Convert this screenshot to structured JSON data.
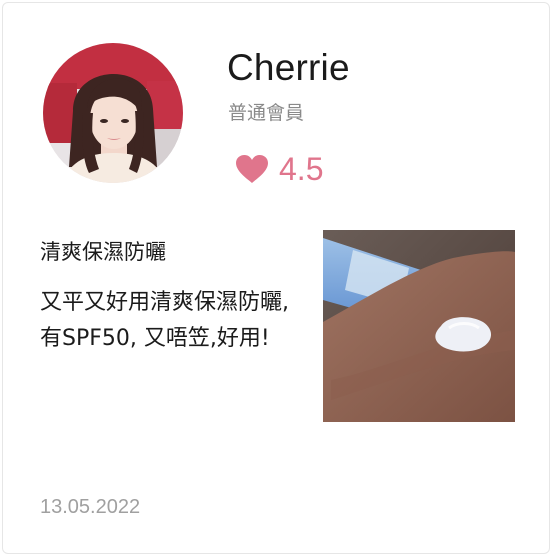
{
  "reviewer": {
    "name": "Cherrie",
    "membership": "普通會員",
    "rating": "4.5",
    "rating_icon": "heart-icon",
    "accent_color": "#e0758c"
  },
  "review": {
    "title": "清爽保濕防曬",
    "body": "又平又好用清爽保濕防曬,有SPF50, 又唔笠,好用!",
    "date": "13.05.2022"
  }
}
